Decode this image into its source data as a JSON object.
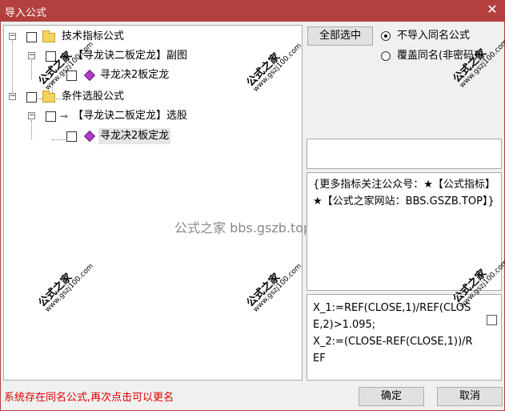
{
  "window": {
    "title": "导入公式",
    "close_glyph": "✕",
    "title_bg": "#b3403e"
  },
  "tree": {
    "groups": [
      {
        "label": "技术指标公式",
        "expander": "−",
        "children": [
          {
            "label": "【寻龙诀二板定龙】副图",
            "expander": "−",
            "children": [
              {
                "label": "寻龙决2板定龙"
              }
            ]
          }
        ]
      },
      {
        "label": "条件选股公式",
        "expander": "−",
        "children": [
          {
            "label": "【寻龙诀二板定龙】选股",
            "expander": "−",
            "children": [
              {
                "label": "寻龙决2板定龙"
              }
            ]
          }
        ]
      }
    ],
    "center_watermark": "公式之家 bbs.gszb.top"
  },
  "watermark": {
    "line1": "公式之家",
    "line2": "www.gszj100.com"
  },
  "actions": {
    "select_all_label": "全部选中",
    "radio_no_import": "不导入同名公式",
    "radio_overwrite": "覆盖同名(非密码)",
    "ok_label": "确定",
    "cancel_label": "取消"
  },
  "description": {
    "text": "{更多指标关注公众号：★【公式指标】★【公式之家网站：BBS.GSZB.TOP】}"
  },
  "code": {
    "text": "X_1:=REF(CLOSE,1)/REF(CLOSE,2)>1.095;\nX_2:=(CLOSE-REF(CLOSE,1))/REF"
  },
  "status": {
    "message": "系统存在同名公式,再次点击可以更名",
    "color": "#e00000"
  }
}
